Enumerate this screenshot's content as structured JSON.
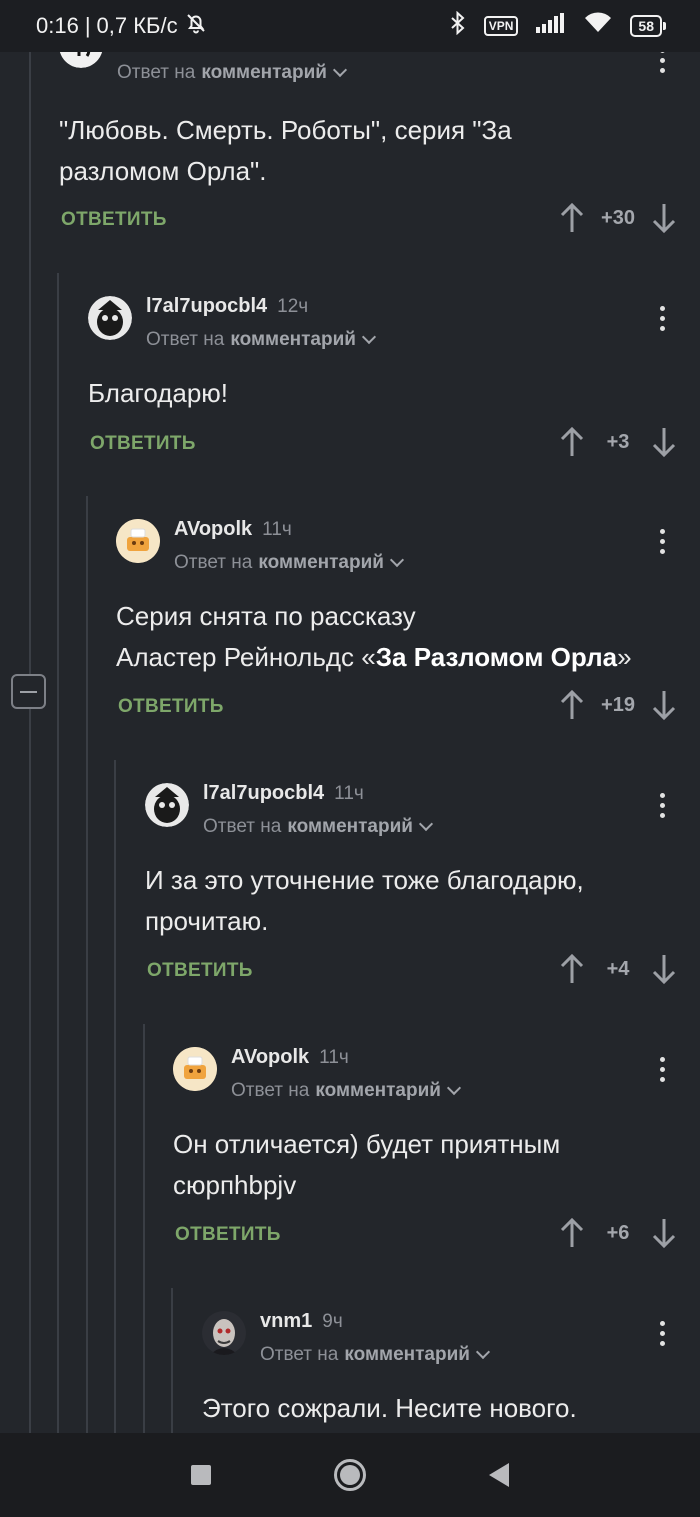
{
  "status_bar": {
    "time": "0:16",
    "separator": "|",
    "speed": "0,7 КБ/с",
    "vpn_label": "VPN",
    "battery": "58"
  },
  "comments": [
    {
      "username": "",
      "time": "",
      "reply_prefix": "Ответ на",
      "reply_target": "комментарий",
      "text_lines": [
        "\"Любовь. Смерть. Роботы\", серия \"За",
        "разломом Орла\"."
      ],
      "reply_label": "ОТВЕТИТЬ",
      "score": "+30"
    },
    {
      "username": "l7al7upocbl4",
      "time": "12ч",
      "reply_prefix": "Ответ на",
      "reply_target": "комментарий",
      "text_lines": [
        "Благодарю!"
      ],
      "reply_label": "ОТВЕТИТЬ",
      "score": "+3"
    },
    {
      "username": "AVopolk",
      "time": "11ч",
      "reply_prefix": "Ответ на",
      "reply_target": "комментарий",
      "text_line1": "Серия снята по рассказу",
      "text_line2_prefix": "Аластер Рейнольдс «",
      "text_line2_bold": "За Разломом Орла",
      "text_line2_suffix": "»",
      "reply_label": "ОТВЕТИТЬ",
      "score": "+19"
    },
    {
      "username": "l7al7upocbl4",
      "time": "11ч",
      "reply_prefix": "Ответ на",
      "reply_target": "комментарий",
      "text_lines": [
        "И за это уточнение тоже благодарю,",
        "прочитаю."
      ],
      "reply_label": "ОТВЕТИТЬ",
      "score": "+4"
    },
    {
      "username": "AVopolk",
      "time": "11ч",
      "reply_prefix": "Ответ на",
      "reply_target": "комментарий",
      "text_lines": [
        "Он отличается) будет приятным",
        "сюрпhbpjv"
      ],
      "reply_label": "ОТВЕТИТЬ",
      "score": "+6"
    },
    {
      "username": "vnm1",
      "time": "9ч",
      "reply_prefix": "Ответ на",
      "reply_target": "комментарий",
      "text_lines": [
        "Этого сожрали. Несите нового."
      ]
    }
  ],
  "colors": {
    "background": "#23262b",
    "reply_green": "#7ea76a",
    "muted": "#8d9097"
  }
}
